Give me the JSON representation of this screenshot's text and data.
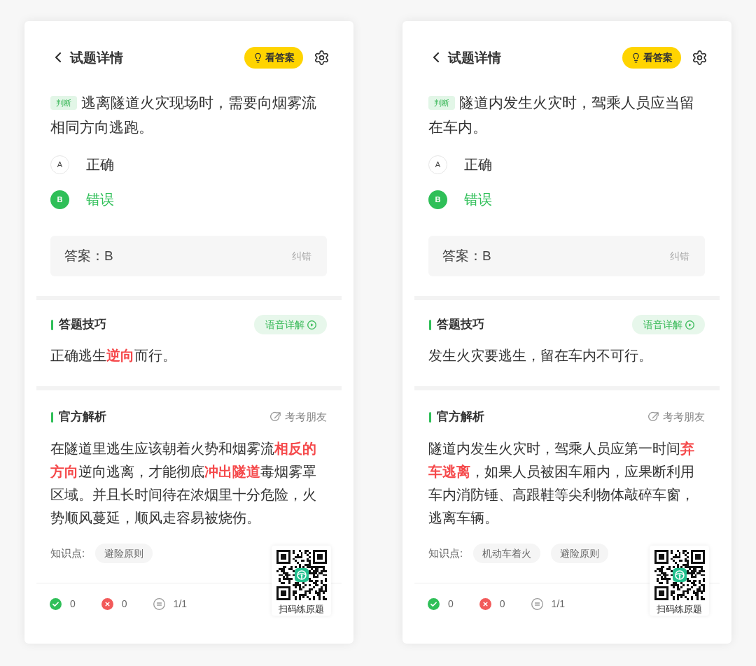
{
  "cards": [
    {
      "header": {
        "title": "试题详情",
        "answer_button": "看答案"
      },
      "question": {
        "type_tag": "判断",
        "text": "逃离隧道火灾现场时，需要向烟雾流相同方向逃跑。"
      },
      "options": [
        {
          "letter": "A",
          "text": "正确",
          "selected": false
        },
        {
          "letter": "B",
          "text": "错误",
          "selected": true
        }
      ],
      "answer": {
        "text": "答案：B",
        "report_link": "纠错"
      },
      "tips": {
        "title": "答题技巧",
        "audio_button": "语音详解",
        "text": "正确逃生**逆向**而行。"
      },
      "explanation": {
        "title": "官方解析",
        "share_link": "考考朋友",
        "text": "在隧道里逃生应该朝着火势和烟雾流**相反的方向**逆向逃离，才能彻底**冲出隧道**毒烟雾罩区域。并且长时间待在浓烟里十分危险，火势顺风蔓延，顺风走容易被烧伤。"
      },
      "knowledge": {
        "label": "知识点:",
        "tags": [
          "避险原则"
        ]
      },
      "stats": [
        {
          "kind": "correct",
          "value": "0"
        },
        {
          "kind": "wrong",
          "value": "0"
        },
        {
          "kind": "progress",
          "value": "1/1"
        }
      ],
      "qr": {
        "caption": "扫码练原题"
      }
    },
    {
      "header": {
        "title": "试题详情",
        "answer_button": "看答案"
      },
      "question": {
        "type_tag": "判断",
        "text": "隧道内发生火灾时，驾乘人员应当留在车内。"
      },
      "options": [
        {
          "letter": "A",
          "text": "正确",
          "selected": false
        },
        {
          "letter": "B",
          "text": "错误",
          "selected": true
        }
      ],
      "answer": {
        "text": "答案：B",
        "report_link": "纠错"
      },
      "tips": {
        "title": "答题技巧",
        "audio_button": "语音详解",
        "text": "发生火灾要逃生，留在车内不可行。"
      },
      "explanation": {
        "title": "官方解析",
        "share_link": "考考朋友",
        "text": "隧道内发生火灾时，驾乘人员应第一时间**弃车逃离**，如果人员被困车厢内，应果断利用车内消防锤、高跟鞋等尖利物体敲碎车窗，逃离车辆。"
      },
      "knowledge": {
        "label": "知识点:",
        "tags": [
          "机动车着火",
          "避险原则"
        ]
      },
      "stats": [
        {
          "kind": "correct",
          "value": "0"
        },
        {
          "kind": "wrong",
          "value": "0"
        },
        {
          "kind": "progress",
          "value": "1/1"
        }
      ],
      "qr": {
        "caption": "扫码练原题"
      }
    }
  ]
}
